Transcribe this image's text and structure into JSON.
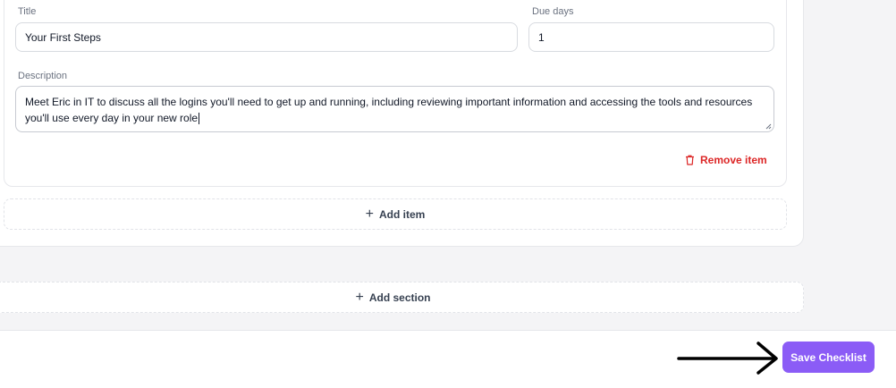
{
  "item": {
    "title_label": "Title",
    "title_value": "Your First Steps",
    "due_label": "Due days",
    "due_value": "1",
    "description_label": "Description",
    "description_value": "Meet Eric in IT to discuss all the logins you'll need to get up and running, including reviewing important information and accessing the tools and resources you'll use every day in your new role",
    "remove_label": "Remove item"
  },
  "add_item_label": "Add item",
  "add_section_label": "Add section",
  "save_label": "Save Checklist",
  "colors": {
    "accent": "#8b5cf6",
    "danger": "#dc2626"
  },
  "icons": {
    "remove": "trash-icon",
    "add": "plus-icon",
    "pointer": "arrow-right-icon"
  }
}
